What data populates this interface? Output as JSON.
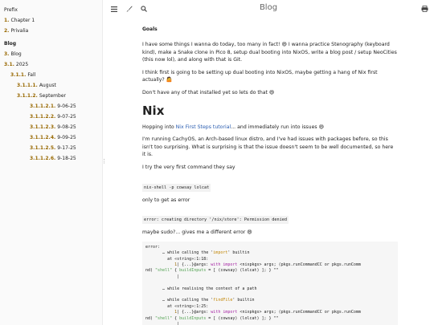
{
  "sidebar": {
    "items": [
      {
        "num": "",
        "label": "Prefix",
        "level": 0
      },
      {
        "num": "1.",
        "label": "Chapter 1",
        "level": 0
      },
      {
        "num": "2.",
        "label": "Privalia",
        "level": 0
      },
      {
        "num": "",
        "label": "Blog",
        "level": 0,
        "bold": true
      },
      {
        "num": "3.",
        "label": "Blog",
        "level": 0
      },
      {
        "num": "3.1.",
        "label": "2025",
        "level": 1
      },
      {
        "num": "3.1.1.",
        "label": "Fall",
        "level": 2
      },
      {
        "num": "3.1.1.1.",
        "label": "August",
        "level": 3
      },
      {
        "num": "3.1.1.2.",
        "label": "September",
        "level": 3
      },
      {
        "num": "3.1.1.2.1.",
        "label": "9-06-25",
        "level": 4
      },
      {
        "num": "3.1.1.2.2.",
        "label": "9-07-25",
        "level": 4
      },
      {
        "num": "3.1.1.2.3.",
        "label": "9-08-25",
        "level": 4
      },
      {
        "num": "3.1.1.2.4.",
        "label": "9-09-25",
        "level": 4
      },
      {
        "num": "3.1.1.2.5.",
        "label": "9-17-25",
        "level": 4
      },
      {
        "num": "3.1.1.2.6.",
        "label": "9-18-25",
        "level": 4
      }
    ]
  },
  "toolbar": {
    "title": "Blog",
    "icons": [
      "menu-icon",
      "brush-icon",
      "search-icon",
      "print-icon"
    ]
  },
  "content": {
    "goals_heading": "Goals",
    "p1": "I have some things I wanna do today, too many in fact! 😄 I wanna practice Stenography (keyboard kind), make a Snake clone in Pico 8, setup dual booting into NixOS, write a blog post / setup NeoCities (this now lol), and along with that is Git.",
    "p2": "I think first is going to be setting up dual booting into NixOS, maybe getting a hang of Nix first actually? 🤷",
    "p3": "Don't have any of that installed yet so lets do that 😄",
    "nix_heading": "Nix",
    "p4_pre": "Hopping into ",
    "p4_link": "Nix First Steps tutorial",
    "p4_post": "... and immediately run into issues 😄",
    "p5": "I'm running CachyOS, an Arch-based linux distro, and I've had issues with packages before, so this isn't too surprising. What is surprising is that the issue doesn't seem to be well documented, so here it is.",
    "p6": "I try the very first command they say",
    "cmd1": "nix-shell -p cowsay lolcat",
    "p7": "only to get as error",
    "cmd2": "error: creating directory '/nix/store': Permission denied",
    "p8": "maybe sudo?... gives me a different error 😄",
    "code_lines": [
      "error:",
      "       … while calling the 'import' builtin",
      "         at «string»:1:18:",
      "            1| {...}@args: with import <nixpkgs> args; (pkgs.runCommandCC or pkgs.runComm",
      "nd) \"shell\" { buildInputs = [ (cowsay) (lolcat) ]; } \"\"",
      "             |",
      "",
      "       … while realising the context of a path",
      "",
      "       … while calling the 'findFile' builtin",
      "         at «string»:1:25:",
      "            1| {...}@args: with import <nixpkgs> args; (pkgs.runCommandCC or pkgs.runComm",
      "nd) \"shell\" { buildInputs = [ (cowsay) (lolcat) ]; } \"\"",
      "             |"
    ]
  }
}
